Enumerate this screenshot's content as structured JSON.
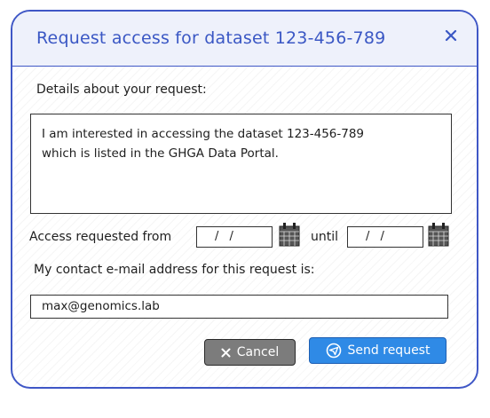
{
  "dialog": {
    "title": "Request access for dataset 123-456-789",
    "close_icon": "close-icon"
  },
  "form": {
    "details_label": "Details about your request:",
    "details_text": "I am interested in accessing the dataset 123-456-789\nwhich is listed in the GHGA Data Portal.",
    "access_from_label": "Access requested from",
    "from_date": "/ /",
    "until_label": "until",
    "until_date": "/ /",
    "calendar_icon": "calendar-icon",
    "email_label": "My contact e-mail address for this request is:",
    "email_value": "max@genomics.lab"
  },
  "buttons": {
    "cancel_label": "Cancel",
    "cancel_icon": "x-icon",
    "send_label": "Send request",
    "send_icon": "send-icon"
  },
  "colors": {
    "accent": "#3a57c4",
    "send_button": "#2f8ae6",
    "cancel_button": "#7c7c7c"
  }
}
